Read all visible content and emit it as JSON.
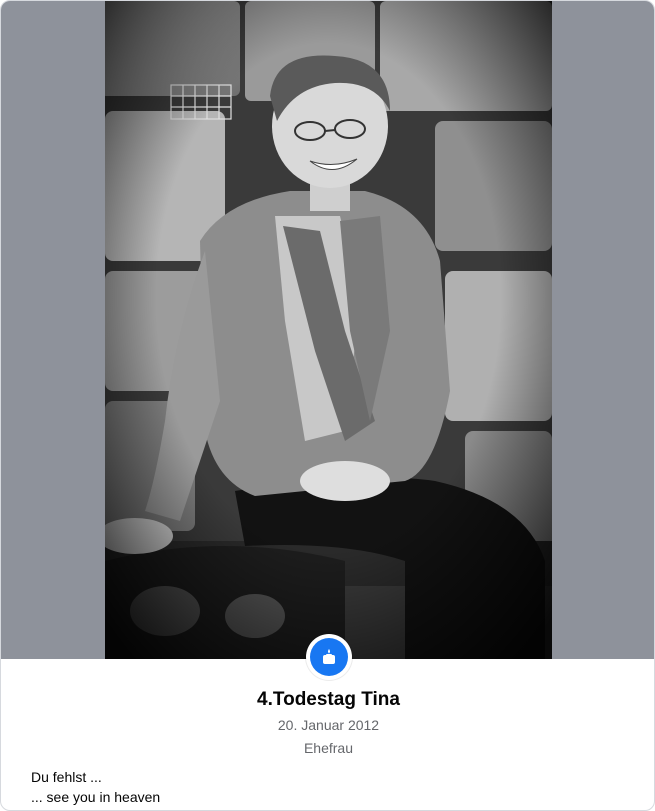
{
  "post": {
    "title": "4.Todestag Tina",
    "date": "20. Januar 2012",
    "relation": "Ehefrau",
    "message_lines": [
      "Du fehlst ...",
      "... see you in heaven"
    ]
  },
  "badge": {
    "icon": "memorial-candle-icon",
    "color": "#1877f2"
  },
  "photo": {
    "style": "black-and-white"
  }
}
